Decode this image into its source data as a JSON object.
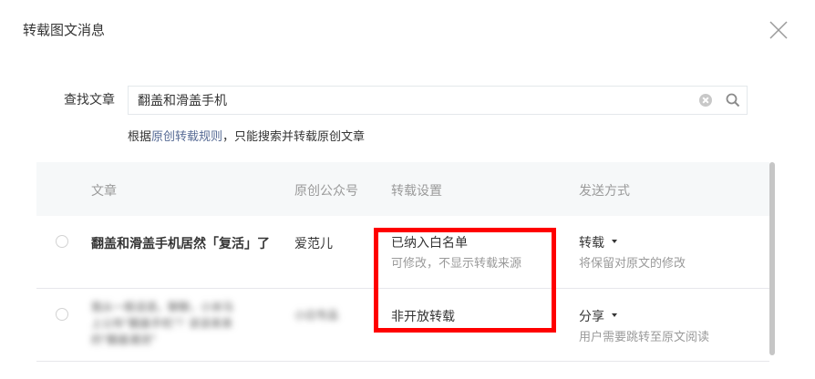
{
  "dialog": {
    "title": "转载图文消息",
    "close_icon": "close-icon"
  },
  "search": {
    "label": "查找文章",
    "value": "翻盖和滑盖手机",
    "clear_icon": "clear-icon",
    "search_icon": "search-icon"
  },
  "hint": {
    "prefix": "根据",
    "link": "原创转载规则",
    "suffix": "，只能搜索并转载原创文章"
  },
  "table": {
    "headers": {
      "article": "文章",
      "account": "原创公众号",
      "repost_setting": "转载设置",
      "send_method": "发送方式"
    },
    "rows": [
      {
        "title": "翻盖和滑盖手机居然「复活」了",
        "account": "爱范儿",
        "setting": "已纳入白名单",
        "setting_note": "可修改，不显示转载来源",
        "method": "转载",
        "method_note": "将保留对原文的修改"
      },
      {
        "title_line1": "我从一般话语，聊聊，小米马",
        "title_line2": "上公布\"翻盖手机\"？该该来来",
        "title_line3": "的\"翻盖潮流\"",
        "account": "小白专品",
        "setting": "非开放转载",
        "method": "分享",
        "method_note": "用户需要跳转至原文阅读"
      }
    ]
  },
  "colors": {
    "link": "#576b95",
    "highlight": "#ff0000",
    "header_bg": "#f6f8f9"
  }
}
